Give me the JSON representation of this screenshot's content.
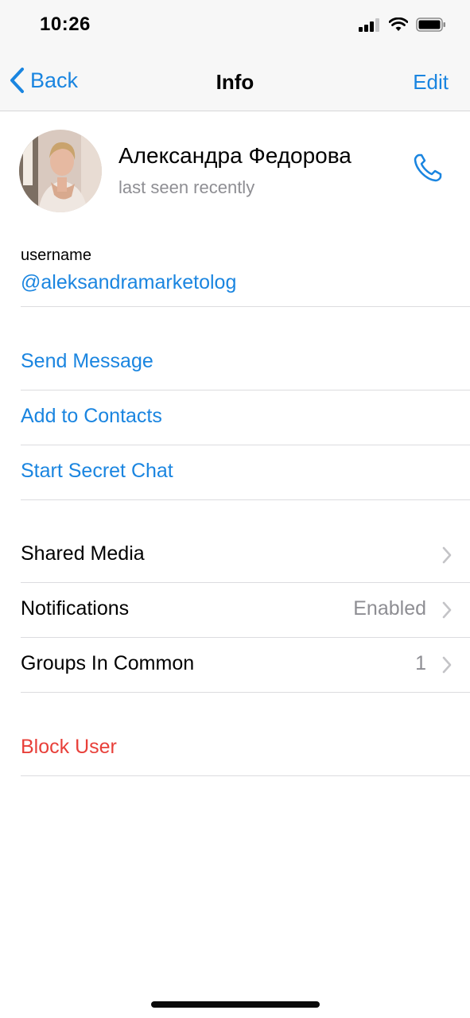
{
  "status_bar": {
    "time": "10:26"
  },
  "nav": {
    "back_label": "Back",
    "title": "Info",
    "edit_label": "Edit"
  },
  "profile": {
    "name": "Александра Федорова",
    "status": "last seen recently"
  },
  "username": {
    "label": "username",
    "value": "@aleksandramarketolog"
  },
  "actions": [
    {
      "label": "Send Message"
    },
    {
      "label": "Add to Contacts"
    },
    {
      "label": "Start Secret Chat"
    }
  ],
  "settings": [
    {
      "label": "Shared Media",
      "value": ""
    },
    {
      "label": "Notifications",
      "value": "Enabled"
    },
    {
      "label": "Groups In Common",
      "value": "1"
    }
  ],
  "danger": {
    "block_label": "Block User"
  },
  "colors": {
    "accent": "#1a85e0",
    "destructive": "#e8403a",
    "secondary_text": "#8e8e93"
  },
  "icons": [
    "signal-icon",
    "wifi-icon",
    "battery-icon",
    "back-chevron-icon",
    "phone-icon",
    "chevron-right-icon"
  ]
}
